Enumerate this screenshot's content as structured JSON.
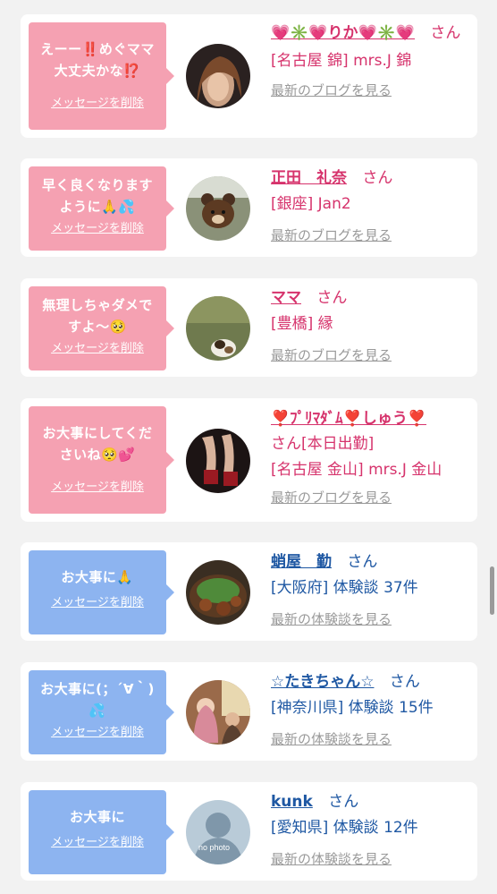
{
  "common": {
    "delete_label": "メッセージを削除",
    "san": "さん"
  },
  "cards": [
    {
      "message": "えーー‼️めぐママ大丈夫かな⁉️",
      "name": "💗✳️💗りか💗✳️💗",
      "location": "[名古屋 錦] mrs.J 錦",
      "link": "最新のブログを見る",
      "theme": "pink",
      "avatar_icon": "woman-photo"
    },
    {
      "message": "早く良くなりますように🙏💦",
      "name": "正田　礼奈",
      "location": "[銀座] Jan2",
      "link": "最新のブログを見る",
      "theme": "pink",
      "avatar_icon": "bear-photo"
    },
    {
      "message": "無理しちゃダメですよ〜🥺",
      "name": "ママ",
      "location": "[豊橋] 縁",
      "link": "最新のブログを見る",
      "theme": "pink",
      "avatar_icon": "dog-photo"
    },
    {
      "message": "お大事にしてくださいね🥺💕",
      "name": "❣️ﾌﾟﾘﾏﾀﾞﾑ❣️しゅう❣️",
      "extra": "[本日出勤]",
      "location": "[名古屋 金山] mrs.J 金山",
      "link": "最新のブログを見る",
      "theme": "pink",
      "avatar_icon": "legs-photo"
    },
    {
      "message": "お大事に🙏",
      "name": "蛸屋　勤",
      "location": "[大阪府] 体験談 37件",
      "link": "最新の体験談を見る",
      "theme": "blue",
      "avatar_icon": "food-photo"
    },
    {
      "message": "お大事に(；´∀｀)💦",
      "name": "☆たきちゃん☆",
      "location": "[神奈川県] 体験談 15件",
      "link": "最新の体験談を見る",
      "theme": "blue",
      "avatar_icon": "group-photo"
    },
    {
      "message": "お大事に",
      "name": "kunk",
      "location": "[愛知県] 体験談 12件",
      "link": "最新の体験談を見る",
      "theme": "blue",
      "avatar_icon": "no-photo",
      "avatar_text": "no photo"
    }
  ]
}
